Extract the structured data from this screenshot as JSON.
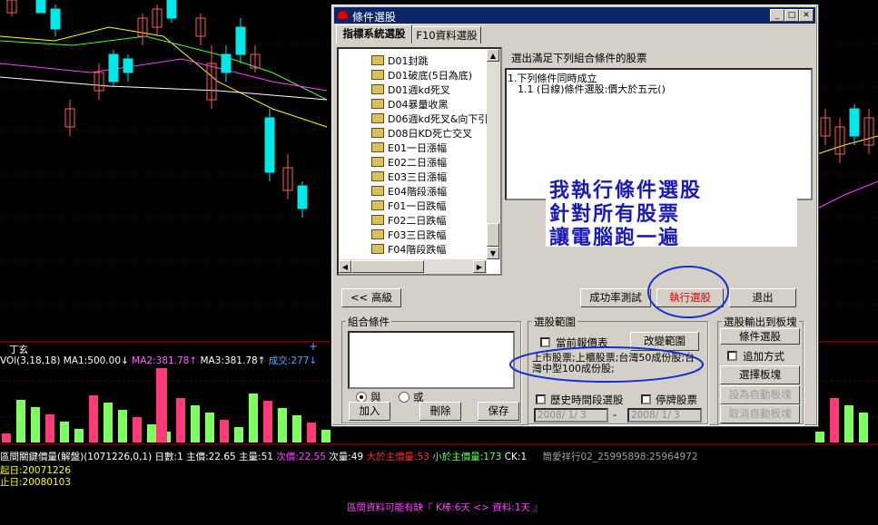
{
  "chart": {
    "indicator_line": {
      "name": "VOl(3,18,18)",
      "ma1": "MA1:500.00↓",
      "ma2": "MA2:381.78↑",
      "ma3": "MA3:381.78↑",
      "volume": "成交:277↓"
    },
    "stock_label": "丁玄",
    "status_line": {
      "func": "區間關鍵價量(解盤)(1071226,0,1)",
      "days": "日數:1",
      "main_price": "主價:22.65",
      "main_volume": "主量:51",
      "second_price": "次價:22.55",
      "second_volume": "次量:49",
      "above": "大於主價量:53",
      "below": "小於主價量:173",
      "ck": "CK:1",
      "code": "筒愛祥行02_25995898:25964972"
    },
    "start_date": "起日:20071226",
    "end_date": "止日:20080103",
    "footer": "區間資料可能有缺『 K棒:6天 <> 資料:1天 』",
    "colors": {
      "up": "#ff5a5a",
      "down": "#00e8e8",
      "vol_up": "#ff3a78",
      "vol_down": "#80ff60",
      "yellow": "#ffff00",
      "magenta": "#ff40ff"
    }
  },
  "dialog": {
    "title": "條件選股",
    "tabs": [
      "指標系統選股",
      "F10資料選股"
    ],
    "tree_items": [
      "D01封跳",
      "D01破底(5日為底)",
      "D01週kd死叉",
      "D04暴量收黑",
      "D06週kd死叉&向下引",
      "D08日KD死亡交叉",
      "E01一日漲幅",
      "E02二日漲幅",
      "E03三日漲幅",
      "E04階段漲幅",
      "F01一日跌幅",
      "F02二日跌幅",
      "F03三日跌幅",
      "F04階段跌幅"
    ],
    "right_header": "選出滿足下列組合條件的股票",
    "condition_lines": [
      "1.下列條件同時成立",
      "1.1 (日線)條件選股:價大於五元()"
    ],
    "callout": [
      "我執行條件選股",
      "針對所有股票",
      "讓電腦跑一遍"
    ],
    "buttons": {
      "advanced": "<< 高級",
      "backtest": "成功率測試",
      "execute": "執行選股",
      "exit": "退出",
      "add": "加入",
      "delete": "刪除",
      "save": "保存",
      "change_range": "改變範圍",
      "select_block": "選擇板塊",
      "set_auto_block": "設為自動板塊",
      "cancel_auto_block": "取消自動板塊",
      "output_mode": "條件選股"
    },
    "combo_group": {
      "label": "組合條件",
      "and": "與",
      "or": "或"
    },
    "range_group": {
      "label": "選股範圍",
      "current_quote": "當前報價表",
      "range_text": "上市股票;上櫃股票;台灣50成份股;台灣中型100成份股;",
      "history_period": "歷史時間段選股",
      "suspended": "停牌股票",
      "date_from": "2008/ 1/ 3",
      "date_sep": "-",
      "date_to": "2008/ 1/ 3"
    },
    "output_group": {
      "label": "選股輸出到板塊",
      "append": "追加方式"
    }
  }
}
